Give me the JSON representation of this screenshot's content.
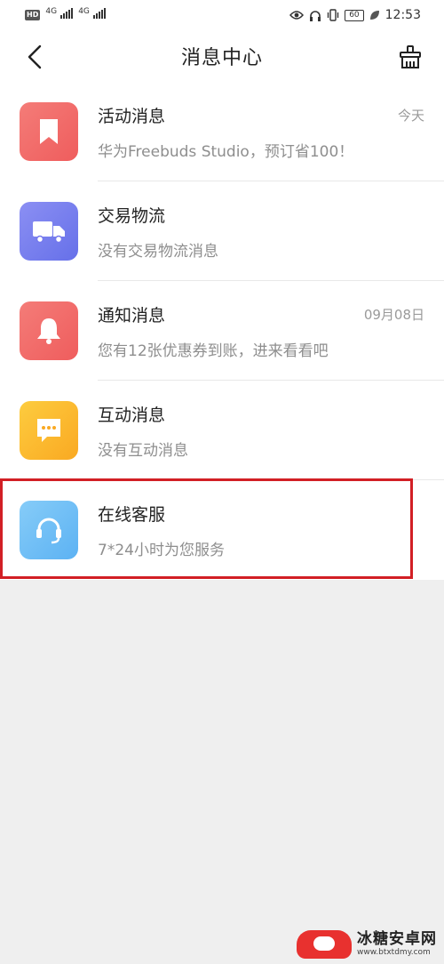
{
  "status_bar": {
    "hd": "HD",
    "sim1_network": "4G",
    "sim2_network": "4G",
    "battery": "60",
    "time": "12:53"
  },
  "header": {
    "title": "消息中心"
  },
  "colors": {
    "activity": "#f26e6e",
    "logistics": "#7579ee",
    "notice": "#f26e6e",
    "interaction": "#fbbb2f",
    "service": "#6cbcf6",
    "highlight": "#d21f25"
  },
  "messages": [
    {
      "icon": "bookmark-icon",
      "title": "活动消息",
      "subtitle": "华为Freebuds Studio，预订省100！",
      "time": "今天"
    },
    {
      "icon": "truck-icon",
      "title": "交易物流",
      "subtitle": "没有交易物流消息",
      "time": ""
    },
    {
      "icon": "bell-icon",
      "title": "通知消息",
      "subtitle": "您有12张优惠券到账，进来看看吧",
      "time": "09月08日"
    },
    {
      "icon": "chat-bubble-icon",
      "title": "互动消息",
      "subtitle": "没有互动消息",
      "time": ""
    },
    {
      "icon": "headset-icon",
      "title": "在线客服",
      "subtitle": "7*24小时为您服务",
      "time": ""
    }
  ],
  "watermark": {
    "title": "冰糖安卓网",
    "url": "www.btxtdmy.com"
  }
}
